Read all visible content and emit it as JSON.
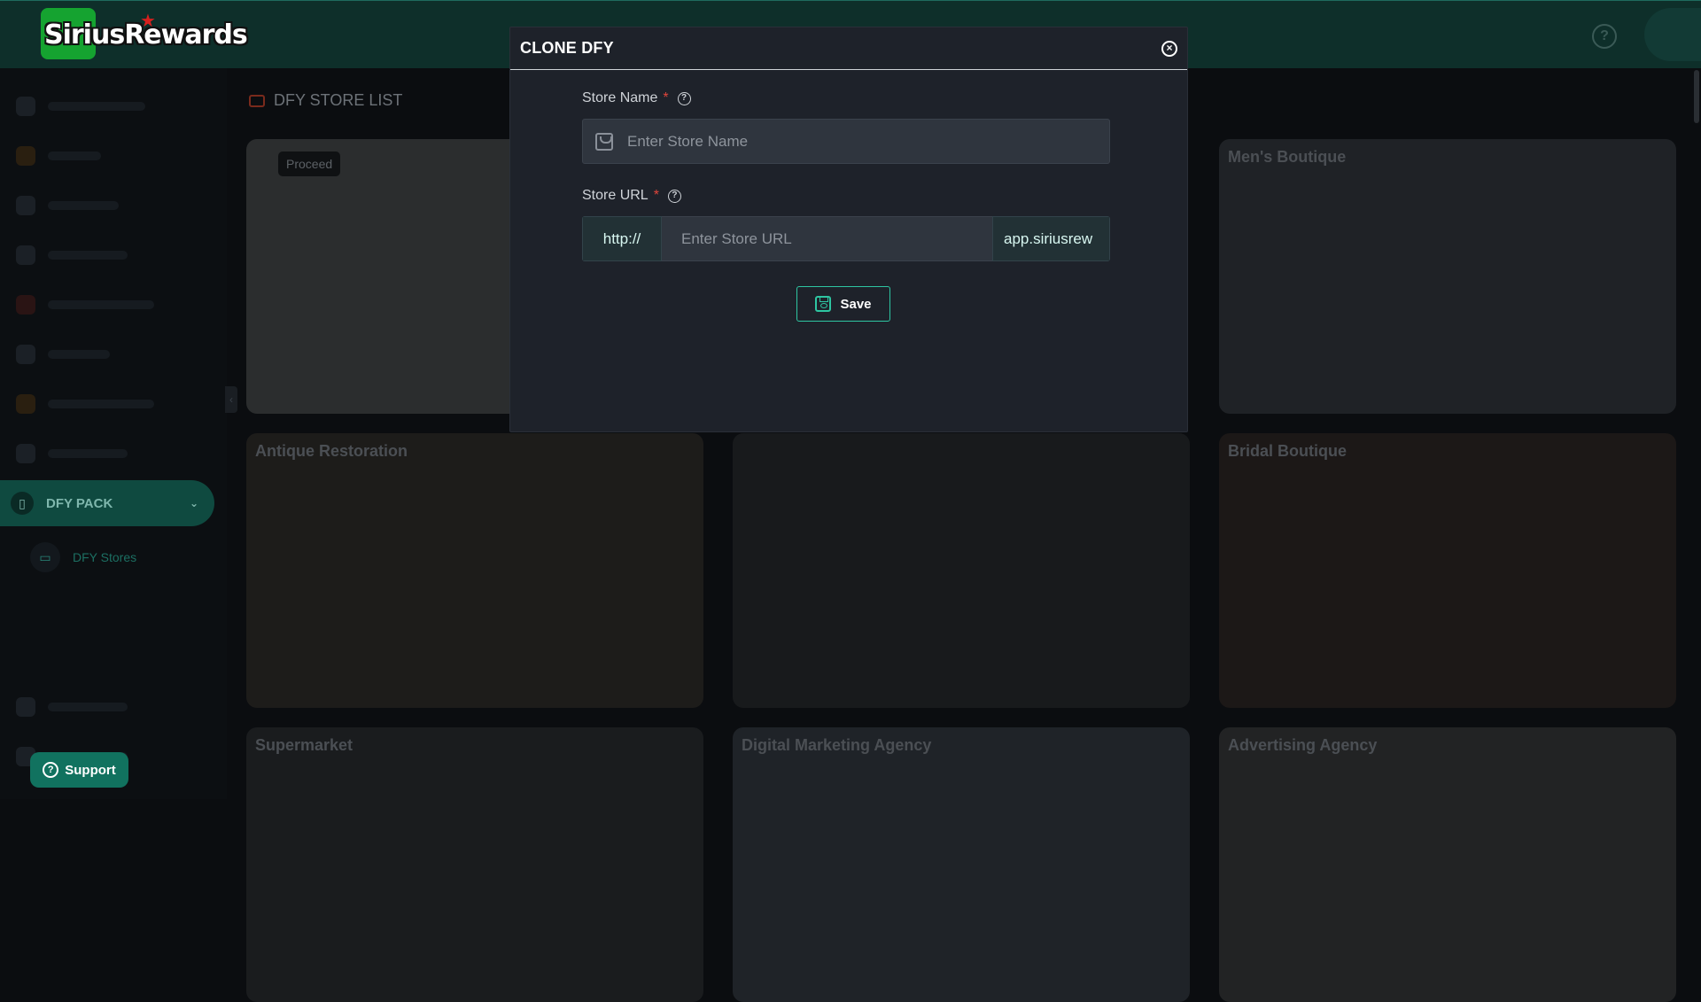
{
  "app": {
    "logo_text_a": "Sirius",
    "logo_text_b": "Rewards",
    "brand_green": "#15a330",
    "accent": "#2ec6a2"
  },
  "sidebar": {
    "section_label": "DFY PACK",
    "active_item": "DFY Stores"
  },
  "support": {
    "label": "Support"
  },
  "store_list": {
    "title": "DFY STORE LIST",
    "proceed_label": "Proceed",
    "cards": [
      {
        "title": ""
      },
      {
        "title": "Men's Boutique"
      },
      {
        "title": "Antique Restoration"
      },
      {
        "title": ""
      },
      {
        "title": "Bridal Boutique"
      },
      {
        "title": "Supermarket"
      },
      {
        "title": "Digital Marketing Agency"
      },
      {
        "title": "Advertising Agency"
      }
    ]
  },
  "modal": {
    "title": "CLONE DFY",
    "store_name": {
      "label": "Store Name",
      "required_mark": "*",
      "placeholder": "Enter Store Name",
      "value": ""
    },
    "store_url": {
      "label": "Store URL",
      "required_mark": "*",
      "prefix": "http://",
      "placeholder": "Enter Store URL",
      "value": "",
      "suffix": "app.siriusrew"
    },
    "save_label": "Save"
  }
}
